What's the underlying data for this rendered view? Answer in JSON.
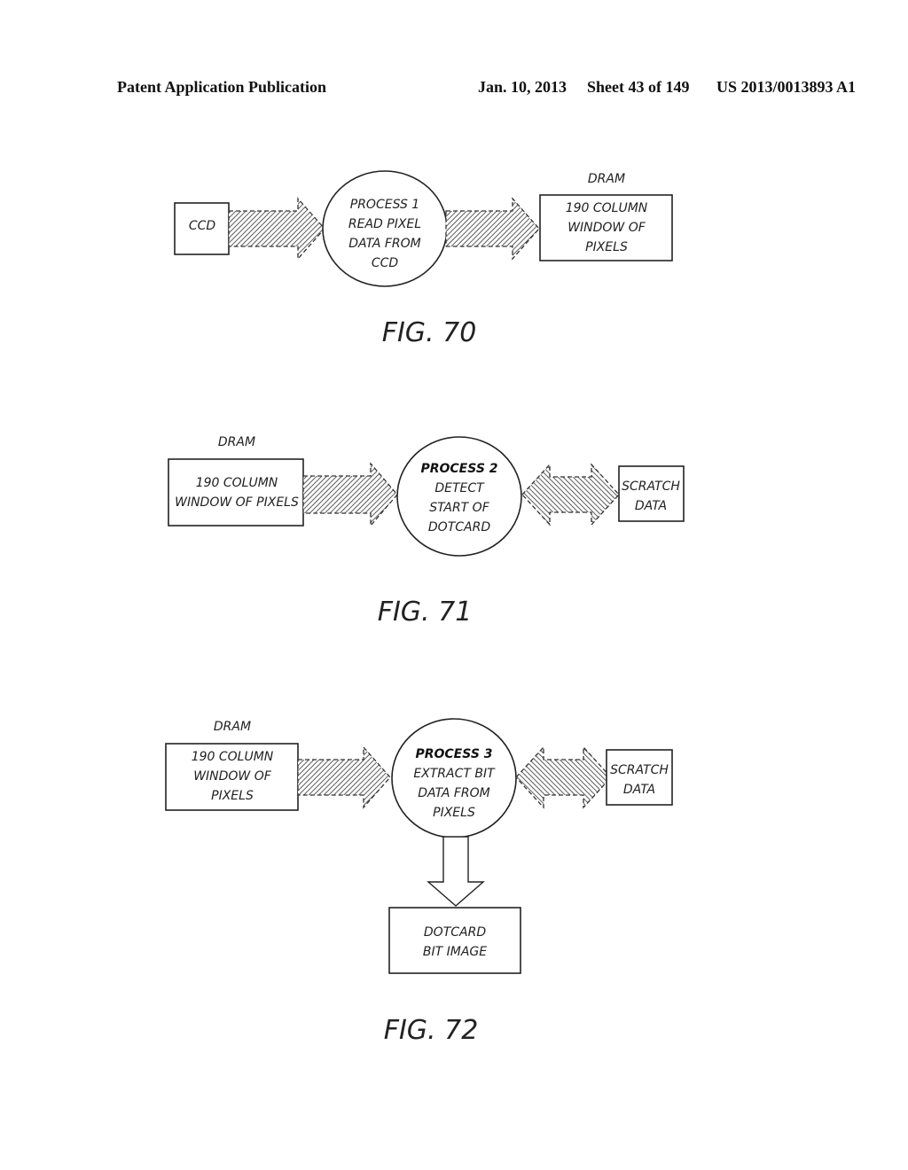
{
  "header": {
    "left": "Patent Application Publication",
    "date": "Jan. 10, 2013",
    "sheet": "Sheet 43 of 149",
    "number": "US 2013/0013893 A1"
  },
  "fig70": {
    "caption": "FIG. 70",
    "source_box": [
      "CCD"
    ],
    "process": [
      "PROCESS 1",
      "READ PIXEL",
      "DATA FROM",
      "CCD"
    ],
    "dest_label": "DRAM",
    "dest_box": [
      "190 COLUMN",
      "WINDOW OF",
      "PIXELS"
    ]
  },
  "fig71": {
    "caption": "FIG. 71",
    "source_label": "DRAM",
    "source_box": [
      "190 COLUMN",
      "WINDOW OF PIXELS"
    ],
    "process": [
      "PROCESS 2",
      "DETECT",
      "START OF",
      "DOTCARD"
    ],
    "scratch_box": [
      "SCRATCH",
      "DATA"
    ]
  },
  "fig72": {
    "caption": "FIG. 72",
    "source_label": "DRAM",
    "source_box": [
      "190 COLUMN",
      "WINDOW OF",
      "PIXELS"
    ],
    "process": [
      "PROCESS 3",
      "EXTRACT BIT",
      "DATA FROM",
      "PIXELS"
    ],
    "scratch_box": [
      "SCRATCH",
      "DATA"
    ],
    "output_box": [
      "DOTCARD",
      "BIT IMAGE"
    ]
  }
}
